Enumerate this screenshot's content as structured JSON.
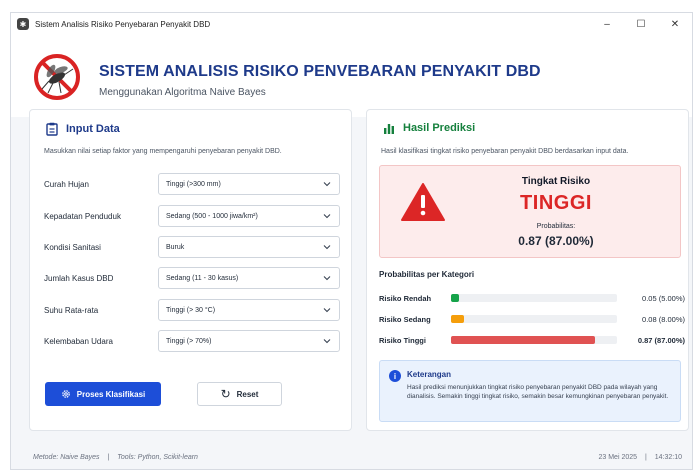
{
  "window": {
    "title": "Sistem Analisis Risiko Penyebaran Penyakit DBD",
    "controls": {
      "minimize": "–",
      "maximize": "☐",
      "close": "✕"
    }
  },
  "header": {
    "title": "SISTEM ANALISIS RISIKO PENVEBARAN PENYAKIT DBD",
    "subtitle": "Menggunakan Algoritma Naive Bayes"
  },
  "input_card": {
    "title": "Input Data",
    "description": "Masukkan nilai setiap faktor yang mempengaruhi penyebaran penyakit DBD.",
    "fields": [
      {
        "label": "Curah Hujan",
        "value": "Tinggi (>300 mm)"
      },
      {
        "label": "Kepadatan Penduduk",
        "value": "Sedang (500 - 1000 jiwa/km²)"
      },
      {
        "label": "Kondisi Sanitasi",
        "value": "Buruk"
      },
      {
        "label": "Jumlah Kasus DBD",
        "value": "Sedang (11 - 30 kasus)"
      },
      {
        "label": "Suhu Rata-rata",
        "value": "Tinggi (> 30 °C)"
      },
      {
        "label": "Kelembaban Udara",
        "value": "Tinggi (> 70%)"
      }
    ],
    "process_button": "Proses Klasifikasi",
    "reset_button": "Reset"
  },
  "result_card": {
    "title": "Hasil Prediksi",
    "description": "Hasil klasifikasi tingkat risiko penyebaran penyakit DBD berdasarkan input data.",
    "risk_label": "Tingkat Risiko",
    "risk_value": "TINGGI",
    "prob_label": "Probabilitas:",
    "prob_value": "0.87 (87.00%)",
    "category_title": "Probabilitas per Kategori",
    "categories": [
      {
        "name": "Risiko Rendah",
        "value": 0.05,
        "text": "0.05 (5.00%)",
        "color": "#16a34a"
      },
      {
        "name": "Risiko Sedang",
        "value": 0.08,
        "text": "0.08 (8.00%)",
        "color": "#f59e0b"
      },
      {
        "name": "Risiko Tinggi",
        "value": 0.87,
        "text": "0.87 (87.00%)",
        "color": "#e05252"
      }
    ],
    "info": {
      "title": "Keterangan",
      "text": "Hasil prediksi menunjukkan tingkat risiko penyebaran penyakit DBD pada wilayah yang dianalisis. Semakin tinggi tingkat risiko, semakin besar kemungkinan penyebaran penyakit."
    }
  },
  "footer": {
    "method": "Metode: Naive Bayes",
    "tools": "Tools: Python, Scikit-learn",
    "date": "23 Mei 2025",
    "time": "14:32:10"
  },
  "colors": {
    "primary": "#1d4ed8",
    "title_blue": "#1e3a8a",
    "risk_red": "#dc2626",
    "success_green": "#15803d"
  }
}
